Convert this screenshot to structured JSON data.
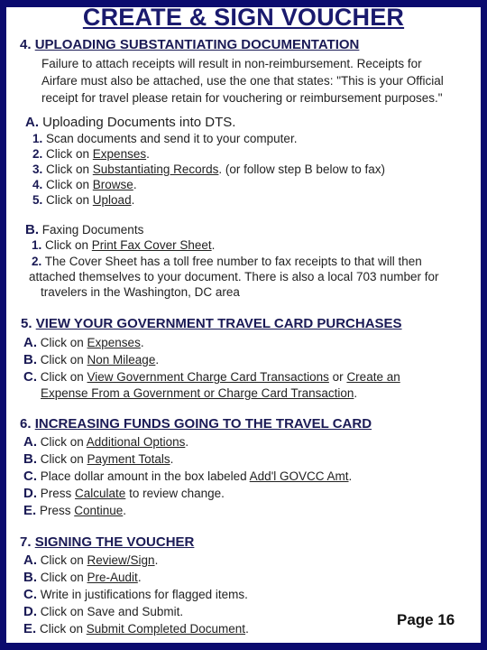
{
  "title": "CREATE & SIGN VOUCHER",
  "sections": {
    "s4": {
      "number": "4.",
      "heading": "UPLOADING SUBSTANTIATING DOCUMENTATION",
      "intro_lines": [
        "Failure to attach receipts will result in non-reimbursement. Receipts for",
        "Airfare must also be attached, use the one that states:  \"This is your Official",
        "receipt for travel please retain for vouchering or reimbursement purposes.\""
      ],
      "A": {
        "label": "A.",
        "title": "Uploading Documents into DTS.",
        "steps": [
          {
            "n": "1.",
            "pre": "Scan documents and send it to your computer.",
            "link": "",
            "post": ""
          },
          {
            "n": "2.",
            "pre": "Click on ",
            "link": "Expenses",
            "post": "."
          },
          {
            "n": "3.",
            "pre": "Click on ",
            "link": "Substantiating Records",
            "post": ". (or follow step B  below to fax)"
          },
          {
            "n": "4.",
            "pre": "Click on ",
            "link": "Browse",
            "post": "."
          },
          {
            "n": "5.",
            "pre": "Click on ",
            "link": "Upload",
            "post": "."
          }
        ]
      },
      "B": {
        "label": "B.",
        "title": "Faxing Documents",
        "step1": {
          "n": "1.",
          "pre": "Click on ",
          "link": "Print Fax Cover Sheet",
          "post": "."
        },
        "step2": {
          "n": "2.",
          "lines": [
            "The Cover Sheet has a toll free number to fax receipts to that will then",
            "attached themselves to your document.    There is also a local 703 number for",
            "travelers in the Washington, DC area"
          ]
        }
      }
    },
    "s5": {
      "number": "5.",
      "heading": "VIEW YOUR GOVERNMENT TRAVEL CARD PURCHASES",
      "items": [
        {
          "label": "A.",
          "pre": "Click on ",
          "link": "Expenses",
          "post": "."
        },
        {
          "label": "B.",
          "pre": "Click on ",
          "link": "Non Mileage",
          "post": "."
        },
        {
          "label": "C.",
          "pre": "Click on ",
          "link": "View Government Charge Card Transactions",
          "mid": " or ",
          "link2": "Create an",
          "link3": "Expense From a Government or Charge Card Transaction",
          "post": "."
        }
      ]
    },
    "s6": {
      "number": "6.",
      "heading": "INCREASING FUNDS GOING TO THE TRAVEL CARD",
      "items": [
        {
          "label": "A.",
          "pre": "Click on ",
          "link": "Additional Options",
          "post": "."
        },
        {
          "label": "B.",
          "pre": "Click on ",
          "link": "Payment Totals",
          "post": "."
        },
        {
          "label": "C.",
          "pre": "Place dollar amount in the box labeled ",
          "link": "Add'l GOVCC Amt",
          "post": "."
        },
        {
          "label": "D.",
          "pre": "Press ",
          "link": "Calculate",
          "post": " to review change."
        },
        {
          "label": "E.",
          "pre": "Press ",
          "link": "Continue",
          "post": "."
        }
      ]
    },
    "s7": {
      "number": "7.",
      "heading": "SIGNING THE VOUCHER",
      "items": [
        {
          "label": "A.",
          "pre": "Click on ",
          "link": "Review/Sign",
          "post": "."
        },
        {
          "label": "B.",
          "pre": "Click on ",
          "link": "Pre-Audit",
          "post": "."
        },
        {
          "label": "C.",
          "pre": "Write in justifications for flagged items.",
          "link": "",
          "post": ""
        },
        {
          "label": "D.",
          "pre": "Click on Save and Submit.",
          "link": "",
          "post": ""
        },
        {
          "label": "E.",
          "pre": "Click on ",
          "link": "Submit Completed Document",
          "post": "."
        }
      ]
    }
  },
  "page_label": "Page 16",
  "colors": {
    "frame": "#0b0b6e",
    "heading": "#1a1a55",
    "background": "#ffffff"
  }
}
